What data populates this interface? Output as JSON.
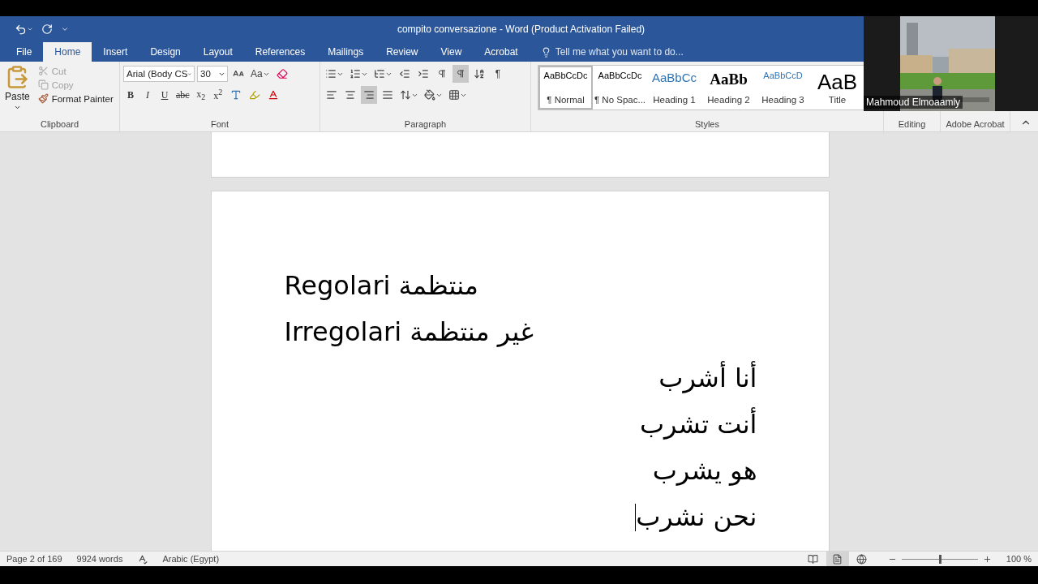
{
  "window": {
    "title": "compito conversazione - Word (Product Activation Failed)"
  },
  "tabs": [
    {
      "label": "File",
      "selected": false
    },
    {
      "label": "Home",
      "selected": true
    },
    {
      "label": "Insert",
      "selected": false
    },
    {
      "label": "Design",
      "selected": false
    },
    {
      "label": "Layout",
      "selected": false
    },
    {
      "label": "References",
      "selected": false
    },
    {
      "label": "Mailings",
      "selected": false
    },
    {
      "label": "Review",
      "selected": false
    },
    {
      "label": "View",
      "selected": false
    },
    {
      "label": "Acrobat",
      "selected": false
    }
  ],
  "tell_me": {
    "placeholder": "Tell me what you want to do..."
  },
  "clipboard": {
    "label": "Clipboard",
    "paste": "Paste",
    "items": [
      {
        "kind": "cut",
        "label": "Cut",
        "disabled": true
      },
      {
        "kind": "copy",
        "label": "Copy",
        "disabled": true
      },
      {
        "kind": "painter",
        "label": "Format Painter",
        "disabled": false
      }
    ]
  },
  "font": {
    "label": "Font",
    "name": "Arial (Body CS",
    "size": "30",
    "change_case": "Aa",
    "buttons": [
      {
        "kind": "bold",
        "text": "B"
      },
      {
        "kind": "italic",
        "text": "I"
      },
      {
        "kind": "underline",
        "text": "U"
      },
      {
        "kind": "strike",
        "text": "abc"
      },
      {
        "kind": "plain",
        "text": "x$_{2}$"
      },
      {
        "kind": "plain",
        "text": "x$^{2}$"
      }
    ]
  },
  "paragraph": {
    "label": "Paragraph",
    "ltr_selected": false,
    "rtl_selected": true,
    "marks": "¶",
    "alignment": [
      {
        "kind": "left",
        "selected": false
      },
      {
        "kind": "center",
        "selected": false
      },
      {
        "kind": "right",
        "selected": true
      },
      {
        "kind": "justify",
        "selected": false
      }
    ]
  },
  "styles": {
    "label": "Styles",
    "items": [
      {
        "kind": "normal",
        "preview": "AaBbCcDc",
        "name": "¶ Normal",
        "selected": true
      },
      {
        "kind": "normal",
        "preview": "AaBbCcDc",
        "name": "¶ No Spac...",
        "selected": false
      },
      {
        "kind": "heading1",
        "preview": "AaBbCc",
        "name": "Heading 1",
        "selected": false
      },
      {
        "kind": "heading2",
        "preview": "AaBb",
        "name": "Heading 2",
        "selected": false
      },
      {
        "kind": "heading3",
        "preview": "AaBbCcD",
        "name": "Heading 3",
        "selected": false
      },
      {
        "kind": "title",
        "preview": "AaB",
        "name": "Title",
        "selected": false
      }
    ]
  },
  "groups": [
    {
      "label": "Editing"
    },
    {
      "label": "Adobe Acrobat"
    }
  ],
  "video": {
    "name": "Mahmoud Elmoaamly"
  },
  "document": {
    "lines": [
      {
        "text": "Regolari منتظمة",
        "kind": "ltr",
        "caret": false
      },
      {
        "text": "Irregolari غير منتظمة",
        "kind": "ltr",
        "caret": false
      },
      {
        "text": "أنا أشرب",
        "kind": "rtl",
        "caret": false
      },
      {
        "text": "أنت تشرب",
        "kind": "rtl",
        "caret": false
      },
      {
        "text": "هو يشرب",
        "kind": "rtl",
        "caret": false
      },
      {
        "text": "نحن نشرب",
        "kind": "rtl",
        "caret": true
      }
    ]
  },
  "status_bar": {
    "page": "Page 2 of 169",
    "words": "9924 words",
    "language": "Arabic (Egypt)",
    "zoom": "100 %",
    "zoom_slider": {
      "level": 0.5
    },
    "views": [
      {
        "kind": "read",
        "selected": false
      },
      {
        "kind": "print",
        "selected": true
      },
      {
        "kind": "web",
        "selected": false
      }
    ]
  }
}
